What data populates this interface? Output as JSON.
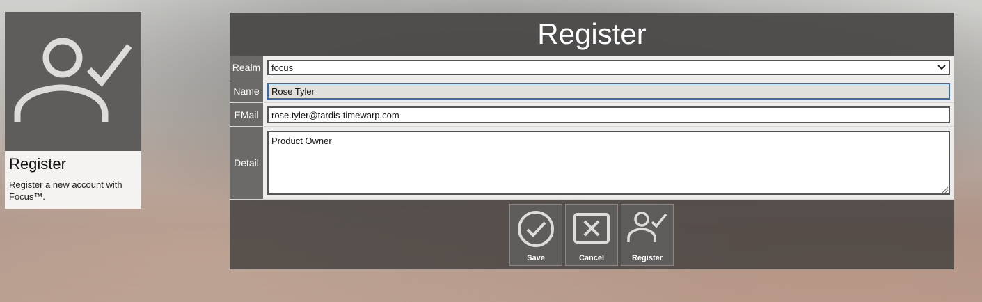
{
  "tile": {
    "icon": "user-check-icon",
    "title": "Register",
    "description": "Register a new account with Focus™."
  },
  "form": {
    "title": "Register",
    "fields": {
      "realm": {
        "label": "Realm",
        "value": "focus"
      },
      "name": {
        "label": "Name",
        "value": "Rose Tyler"
      },
      "email": {
        "label": "EMail",
        "value": "rose.tyler@tardis-timewarp.com"
      },
      "detail": {
        "label": "Detail",
        "value": "Product Owner"
      }
    },
    "buttons": {
      "save": {
        "label": "Save",
        "icon": "check-circle-icon"
      },
      "cancel": {
        "label": "Cancel",
        "icon": "close-box-icon"
      },
      "register": {
        "label": "Register",
        "icon": "user-check-icon"
      }
    }
  },
  "colors": {
    "panel_header": "#504e4c",
    "label_bg": "#6c6a68",
    "focus_border": "#2f6db5"
  }
}
